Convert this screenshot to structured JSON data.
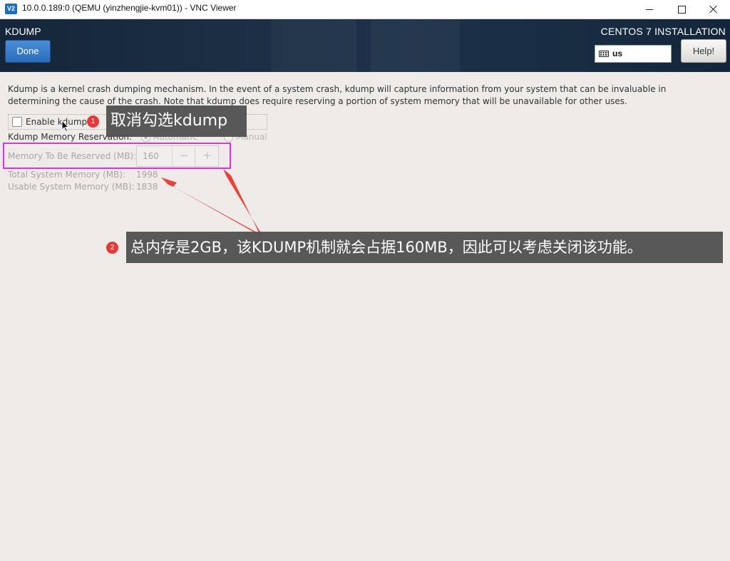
{
  "window": {
    "logo_text": "V2",
    "title": "10.0.0.189:0 (QEMU (yinzhengjie-kvm01)) - VNC Viewer"
  },
  "header": {
    "spoke_title": "KDUMP",
    "done_label": "Done",
    "product_title": "CENTOS 7 INSTALLATION",
    "keyboard_layout": "us",
    "help_label": "Help!"
  },
  "kdump": {
    "description": "Kdump is a kernel crash dumping mechanism. In the event of a system crash, kdump will capture information from your system that can be invaluable in determining the cause of the crash. Note that kdump does require reserving a portion of system memory that will be unavailable for other uses.",
    "enable_label": "Enable kdump",
    "enable_checked": false,
    "reservation_label": "Kdump Memory Reservation:",
    "reservation_options": [
      "Automatic",
      "Manual"
    ],
    "reservation_selected": "Automatic",
    "reserved_label": "Memory To Be Reserved (MB):",
    "reserved_value": "160",
    "decrement": "−",
    "increment": "+",
    "total_label": "Total System Memory (MB):",
    "total_value": "1998",
    "usable_label": "Usable System Memory (MB):",
    "usable_value": "1838"
  },
  "annotations": {
    "badge1": "1",
    "callout1": "取消勾选kdump",
    "badge2": "2",
    "callout2": "总内存是2GB，该KDUMP机制就会占据160MB，因此可以考虑关闭该功能。",
    "highlight_color": "#e030e0",
    "arrow_color": "#e8423a",
    "badge_color": "#e63a3a"
  },
  "colors": {
    "header_bg": "#1b2e44",
    "done_button": "#2a6cb8",
    "content_bg": "#eeebe8"
  }
}
